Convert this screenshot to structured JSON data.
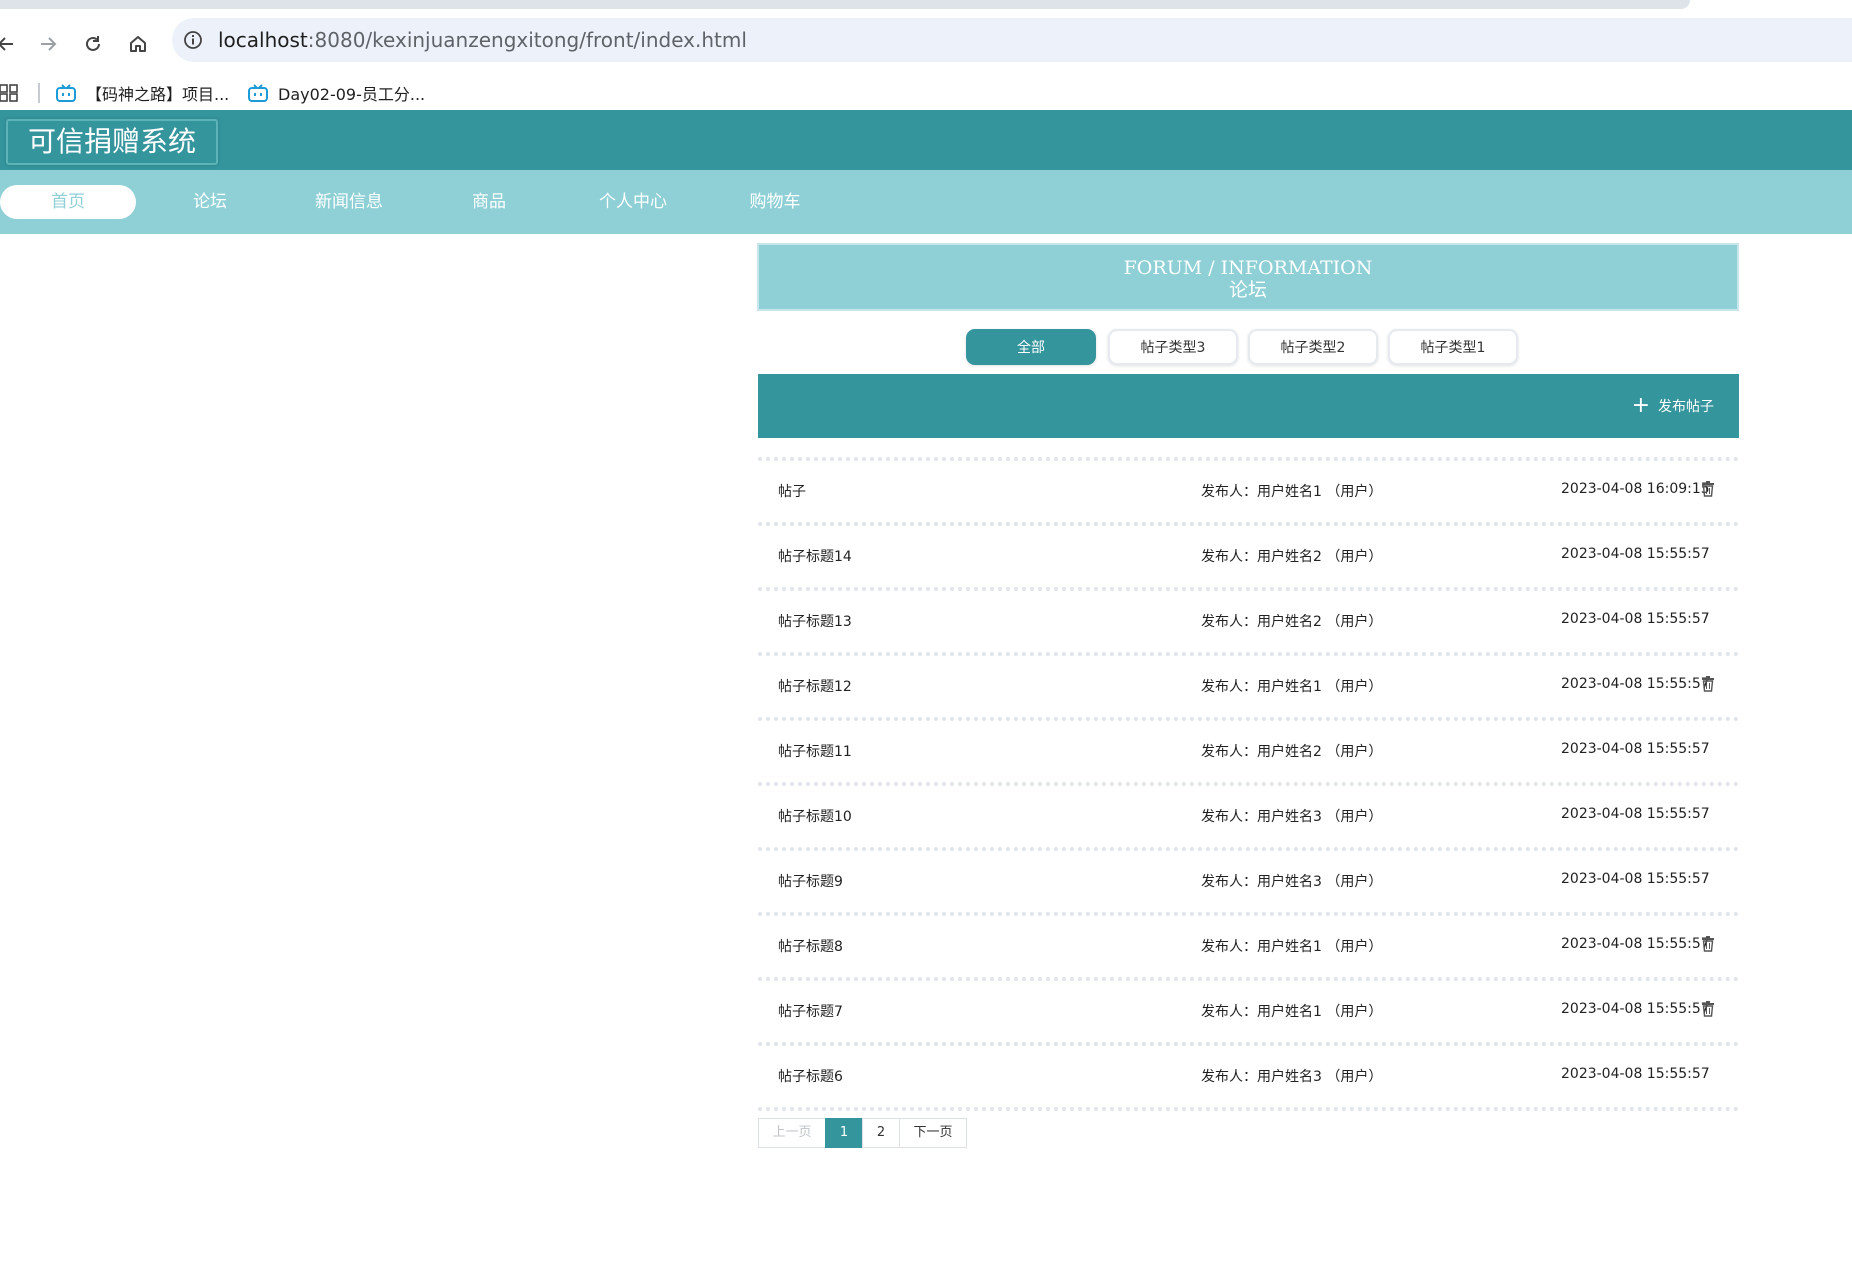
{
  "browser": {
    "url_host": "localhost",
    "url_path": ":8080/kexinjuanzengxitong/front/index.html",
    "bookmarks": [
      {
        "label": "【码神之路】项目...",
        "icon": "bilibili-icon"
      },
      {
        "label": "Day02-09-员工分...",
        "icon": "bilibili-icon"
      }
    ]
  },
  "site": {
    "logo": "可信捐赠系统",
    "nav": [
      {
        "label": "首页",
        "active": true
      },
      {
        "label": "论坛",
        "active": false
      },
      {
        "label": "新闻信息",
        "active": false
      },
      {
        "label": "商品",
        "active": false
      },
      {
        "label": "个人中心",
        "active": false
      },
      {
        "label": "购物车",
        "active": false
      }
    ]
  },
  "forum": {
    "title_en": "FORUM / INFORMATION",
    "title_cn": "论坛",
    "filters": [
      {
        "label": "全部",
        "active": true
      },
      {
        "label": "帖子类型3",
        "active": false
      },
      {
        "label": "帖子类型2",
        "active": false
      },
      {
        "label": "帖子类型1",
        "active": false
      }
    ],
    "publish_label": "发布帖子",
    "posts": [
      {
        "title": "帖子",
        "author": "发布人：用户姓名1 （用户）",
        "time": "2023-04-08 16:09:15",
        "deletable": true
      },
      {
        "title": "帖子标题14",
        "author": "发布人：用户姓名2 （用户）",
        "time": "2023-04-08 15:55:57",
        "deletable": false
      },
      {
        "title": "帖子标题13",
        "author": "发布人：用户姓名2 （用户）",
        "time": "2023-04-08 15:55:57",
        "deletable": false
      },
      {
        "title": "帖子标题12",
        "author": "发布人：用户姓名1 （用户）",
        "time": "2023-04-08 15:55:57",
        "deletable": true
      },
      {
        "title": "帖子标题11",
        "author": "发布人：用户姓名2 （用户）",
        "time": "2023-04-08 15:55:57",
        "deletable": false
      },
      {
        "title": "帖子标题10",
        "author": "发布人：用户姓名3 （用户）",
        "time": "2023-04-08 15:55:57",
        "deletable": false
      },
      {
        "title": "帖子标题9",
        "author": "发布人：用户姓名3 （用户）",
        "time": "2023-04-08 15:55:57",
        "deletable": false
      },
      {
        "title": "帖子标题8",
        "author": "发布人：用户姓名1 （用户）",
        "time": "2023-04-08 15:55:57",
        "deletable": true
      },
      {
        "title": "帖子标题7",
        "author": "发布人：用户姓名1 （用户）",
        "time": "2023-04-08 15:55:57",
        "deletable": true
      },
      {
        "title": "帖子标题6",
        "author": "发布人：用户姓名3 （用户）",
        "time": "2023-04-08 15:55:57",
        "deletable": false
      }
    ],
    "pager": {
      "prev": "上一页",
      "pages": [
        "1",
        "2"
      ],
      "current": "1",
      "next": "下一页"
    }
  },
  "colors": {
    "header_teal": "#35959d",
    "nav_light_teal": "#8ed0d6"
  }
}
